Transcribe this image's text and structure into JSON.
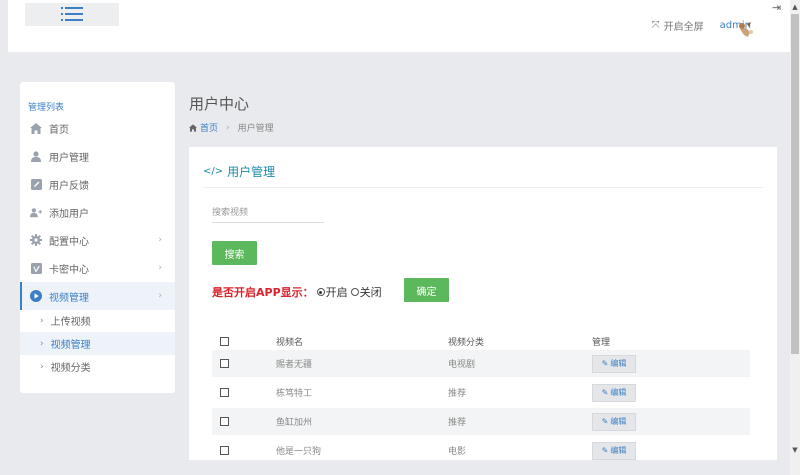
{
  "header": {
    "fullscreen_label": "开启全屏",
    "admin_name": "admin"
  },
  "sidebar": {
    "title": "管理列表",
    "items": [
      {
        "label": "首页",
        "icon": "home-icon"
      },
      {
        "label": "用户管理",
        "icon": "user-icon"
      },
      {
        "label": "用户反馈",
        "icon": "edit-icon"
      },
      {
        "label": "添加用户",
        "icon": "add-user-icon"
      },
      {
        "label": "配置中心",
        "icon": "gear-icon"
      },
      {
        "label": "卡密中心",
        "icon": "vimeo-icon"
      },
      {
        "label": "视频管理",
        "icon": "play-circle-icon"
      }
    ],
    "subitems": [
      {
        "label": "上传视频"
      },
      {
        "label": "视频管理"
      },
      {
        "label": "视频分类"
      }
    ]
  },
  "page": {
    "title": "用户中心",
    "breadcrumb_home": "首页",
    "breadcrumb_current": "用户管理"
  },
  "card": {
    "title": "用户管理",
    "search_placeholder": "搜索视频",
    "search_button": "搜索",
    "app_label": "是否开启APP显示：",
    "radio_on": "开启",
    "radio_off": "关闭",
    "confirm_button": "确定"
  },
  "table": {
    "headers": [
      "视频名",
      "视频分类",
      "管理"
    ],
    "edit_label": "编辑",
    "rows": [
      {
        "name": "赐者无疆",
        "category": "电视剧"
      },
      {
        "name": "栋笃特工",
        "category": "推荐"
      },
      {
        "name": "鱼缸加州",
        "category": "推荐"
      },
      {
        "name": "他是一只狗",
        "category": "电影"
      }
    ]
  },
  "colors": {
    "accent": "#3d7fc4",
    "title_teal": "#1e88a8",
    "button_green": "#5cb85c",
    "warning_red": "#d9232d"
  }
}
